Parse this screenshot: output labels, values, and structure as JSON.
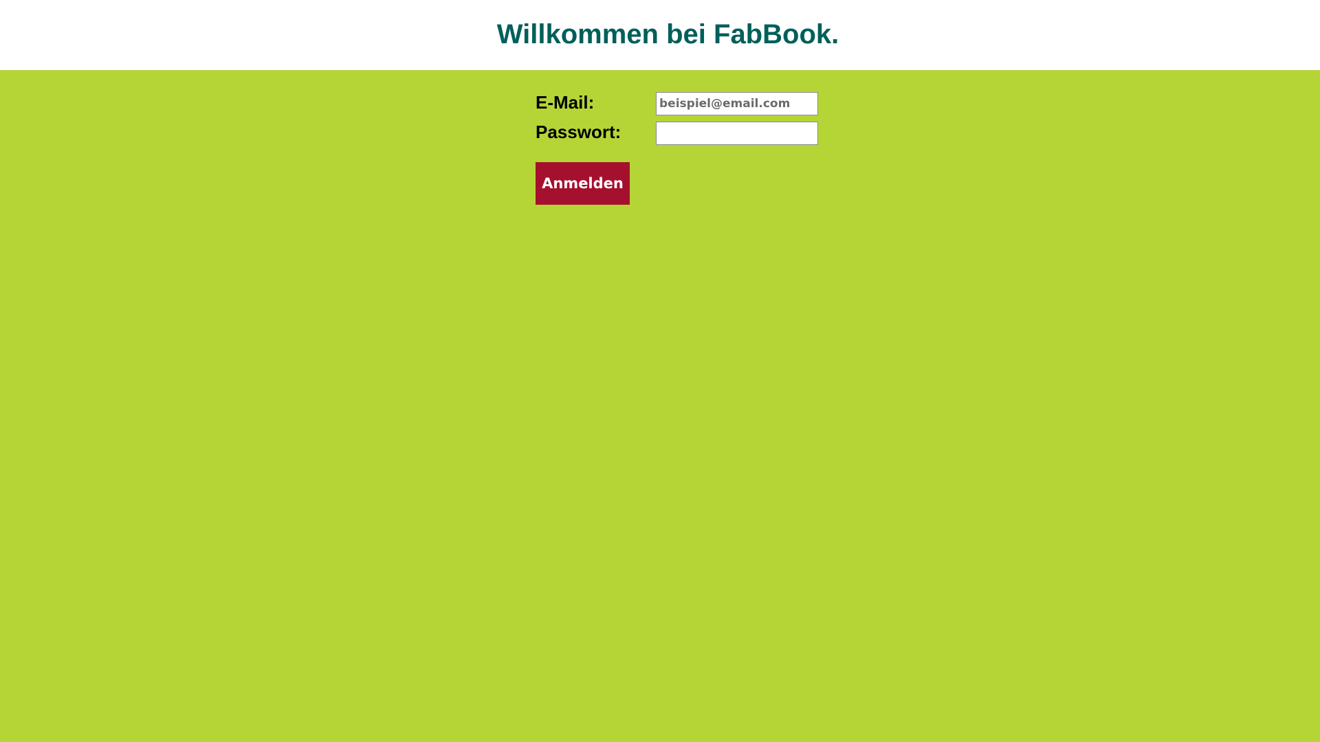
{
  "header": {
    "title": "Willkommen bei FabBook."
  },
  "login_form": {
    "email_label": "E-Mail:",
    "email_value": "",
    "email_placeholder": "beispiel@email.com",
    "password_label": "Passwort:",
    "password_value": "",
    "password_placeholder": "",
    "submit_label": "Anmelden"
  },
  "colors": {
    "title_text": "#005f5a",
    "page_background": "#b5d536",
    "header_background": "#ffffff",
    "button_background": "#a5102e",
    "button_text": "#ffffff",
    "label_text": "#000000"
  }
}
